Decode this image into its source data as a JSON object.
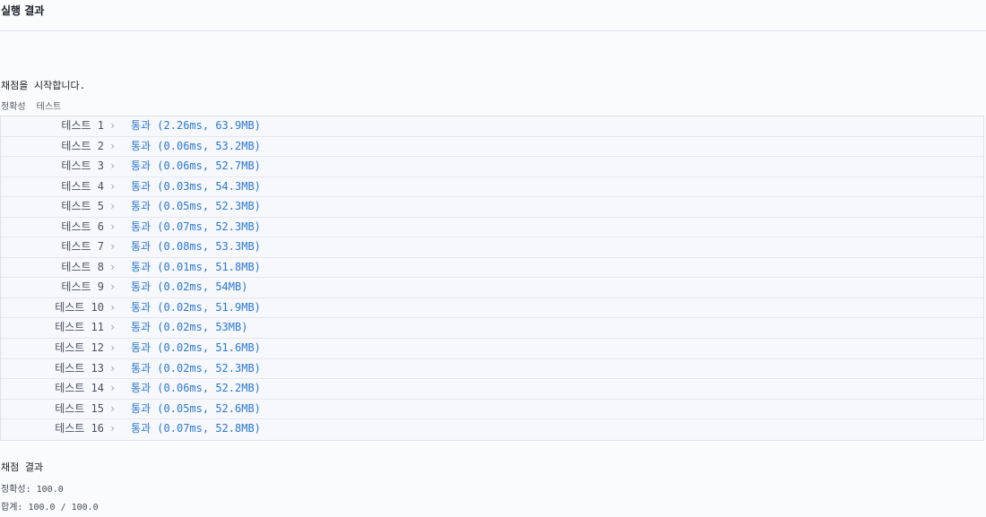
{
  "panel": {
    "title": "실행 결과"
  },
  "messages": {
    "start": "채점을 시작합니다."
  },
  "groups": [
    {
      "label": "정확성  테스트"
    }
  ],
  "results": [
    {
      "label": "테스트 1",
      "result": "통과 (2.26ms, 63.9MB)"
    },
    {
      "label": "테스트 2",
      "result": "통과 (0.06ms, 53.2MB)"
    },
    {
      "label": "테스트 3",
      "result": "통과 (0.06ms, 52.7MB)"
    },
    {
      "label": "테스트 4",
      "result": "통과 (0.03ms, 54.3MB)"
    },
    {
      "label": "테스트 5",
      "result": "통과 (0.05ms, 52.3MB)"
    },
    {
      "label": "테스트 6",
      "result": "통과 (0.07ms, 52.3MB)"
    },
    {
      "label": "테스트 7",
      "result": "통과 (0.08ms, 53.3MB)"
    },
    {
      "label": "테스트 8",
      "result": "통과 (0.01ms, 51.8MB)"
    },
    {
      "label": "테스트 9",
      "result": "통과 (0.02ms, 54MB)"
    },
    {
      "label": "테스트 10",
      "result": "통과 (0.02ms, 51.9MB)"
    },
    {
      "label": "테스트 11",
      "result": "통과 (0.02ms, 53MB)"
    },
    {
      "label": "테스트 12",
      "result": "통과 (0.02ms, 51.6MB)"
    },
    {
      "label": "테스트 13",
      "result": "통과 (0.02ms, 52.3MB)"
    },
    {
      "label": "테스트 14",
      "result": "통과 (0.06ms, 52.2MB)"
    },
    {
      "label": "테스트 15",
      "result": "통과 (0.05ms, 52.6MB)"
    },
    {
      "label": "테스트 16",
      "result": "통과 (0.07ms, 52.8MB)"
    }
  ],
  "summary": {
    "title": "채점 결과",
    "accuracy": "정확성: 100.0",
    "total": "합계: 100.0 / 100.0"
  },
  "icons": {
    "row_chevron": "›"
  },
  "colors": {
    "pass": "#2b78d0",
    "background": "#fafbfd"
  }
}
